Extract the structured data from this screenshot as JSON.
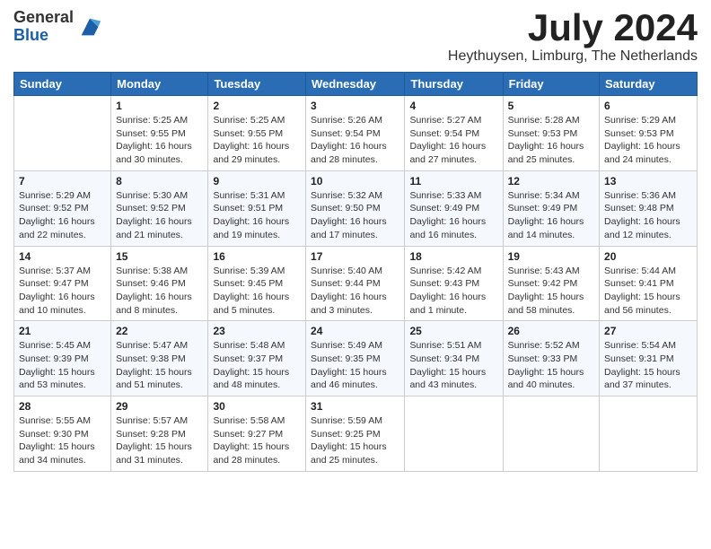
{
  "logo": {
    "general": "General",
    "blue": "Blue"
  },
  "title": "July 2024",
  "location": "Heythuysen, Limburg, The Netherlands",
  "days_of_week": [
    "Sunday",
    "Monday",
    "Tuesday",
    "Wednesday",
    "Thursday",
    "Friday",
    "Saturday"
  ],
  "weeks": [
    [
      {
        "day": "",
        "info": ""
      },
      {
        "day": "1",
        "info": "Sunrise: 5:25 AM\nSunset: 9:55 PM\nDaylight: 16 hours\nand 30 minutes."
      },
      {
        "day": "2",
        "info": "Sunrise: 5:25 AM\nSunset: 9:55 PM\nDaylight: 16 hours\nand 29 minutes."
      },
      {
        "day": "3",
        "info": "Sunrise: 5:26 AM\nSunset: 9:54 PM\nDaylight: 16 hours\nand 28 minutes."
      },
      {
        "day": "4",
        "info": "Sunrise: 5:27 AM\nSunset: 9:54 PM\nDaylight: 16 hours\nand 27 minutes."
      },
      {
        "day": "5",
        "info": "Sunrise: 5:28 AM\nSunset: 9:53 PM\nDaylight: 16 hours\nand 25 minutes."
      },
      {
        "day": "6",
        "info": "Sunrise: 5:29 AM\nSunset: 9:53 PM\nDaylight: 16 hours\nand 24 minutes."
      }
    ],
    [
      {
        "day": "7",
        "info": "Sunrise: 5:29 AM\nSunset: 9:52 PM\nDaylight: 16 hours\nand 22 minutes."
      },
      {
        "day": "8",
        "info": "Sunrise: 5:30 AM\nSunset: 9:52 PM\nDaylight: 16 hours\nand 21 minutes."
      },
      {
        "day": "9",
        "info": "Sunrise: 5:31 AM\nSunset: 9:51 PM\nDaylight: 16 hours\nand 19 minutes."
      },
      {
        "day": "10",
        "info": "Sunrise: 5:32 AM\nSunset: 9:50 PM\nDaylight: 16 hours\nand 17 minutes."
      },
      {
        "day": "11",
        "info": "Sunrise: 5:33 AM\nSunset: 9:49 PM\nDaylight: 16 hours\nand 16 minutes."
      },
      {
        "day": "12",
        "info": "Sunrise: 5:34 AM\nSunset: 9:49 PM\nDaylight: 16 hours\nand 14 minutes."
      },
      {
        "day": "13",
        "info": "Sunrise: 5:36 AM\nSunset: 9:48 PM\nDaylight: 16 hours\nand 12 minutes."
      }
    ],
    [
      {
        "day": "14",
        "info": "Sunrise: 5:37 AM\nSunset: 9:47 PM\nDaylight: 16 hours\nand 10 minutes."
      },
      {
        "day": "15",
        "info": "Sunrise: 5:38 AM\nSunset: 9:46 PM\nDaylight: 16 hours\nand 8 minutes."
      },
      {
        "day": "16",
        "info": "Sunrise: 5:39 AM\nSunset: 9:45 PM\nDaylight: 16 hours\nand 5 minutes."
      },
      {
        "day": "17",
        "info": "Sunrise: 5:40 AM\nSunset: 9:44 PM\nDaylight: 16 hours\nand 3 minutes."
      },
      {
        "day": "18",
        "info": "Sunrise: 5:42 AM\nSunset: 9:43 PM\nDaylight: 16 hours\nand 1 minute."
      },
      {
        "day": "19",
        "info": "Sunrise: 5:43 AM\nSunset: 9:42 PM\nDaylight: 15 hours\nand 58 minutes."
      },
      {
        "day": "20",
        "info": "Sunrise: 5:44 AM\nSunset: 9:41 PM\nDaylight: 15 hours\nand 56 minutes."
      }
    ],
    [
      {
        "day": "21",
        "info": "Sunrise: 5:45 AM\nSunset: 9:39 PM\nDaylight: 15 hours\nand 53 minutes."
      },
      {
        "day": "22",
        "info": "Sunrise: 5:47 AM\nSunset: 9:38 PM\nDaylight: 15 hours\nand 51 minutes."
      },
      {
        "day": "23",
        "info": "Sunrise: 5:48 AM\nSunset: 9:37 PM\nDaylight: 15 hours\nand 48 minutes."
      },
      {
        "day": "24",
        "info": "Sunrise: 5:49 AM\nSunset: 9:35 PM\nDaylight: 15 hours\nand 46 minutes."
      },
      {
        "day": "25",
        "info": "Sunrise: 5:51 AM\nSunset: 9:34 PM\nDaylight: 15 hours\nand 43 minutes."
      },
      {
        "day": "26",
        "info": "Sunrise: 5:52 AM\nSunset: 9:33 PM\nDaylight: 15 hours\nand 40 minutes."
      },
      {
        "day": "27",
        "info": "Sunrise: 5:54 AM\nSunset: 9:31 PM\nDaylight: 15 hours\nand 37 minutes."
      }
    ],
    [
      {
        "day": "28",
        "info": "Sunrise: 5:55 AM\nSunset: 9:30 PM\nDaylight: 15 hours\nand 34 minutes."
      },
      {
        "day": "29",
        "info": "Sunrise: 5:57 AM\nSunset: 9:28 PM\nDaylight: 15 hours\nand 31 minutes."
      },
      {
        "day": "30",
        "info": "Sunrise: 5:58 AM\nSunset: 9:27 PM\nDaylight: 15 hours\nand 28 minutes."
      },
      {
        "day": "31",
        "info": "Sunrise: 5:59 AM\nSunset: 9:25 PM\nDaylight: 15 hours\nand 25 minutes."
      },
      {
        "day": "",
        "info": ""
      },
      {
        "day": "",
        "info": ""
      },
      {
        "day": "",
        "info": ""
      }
    ]
  ]
}
